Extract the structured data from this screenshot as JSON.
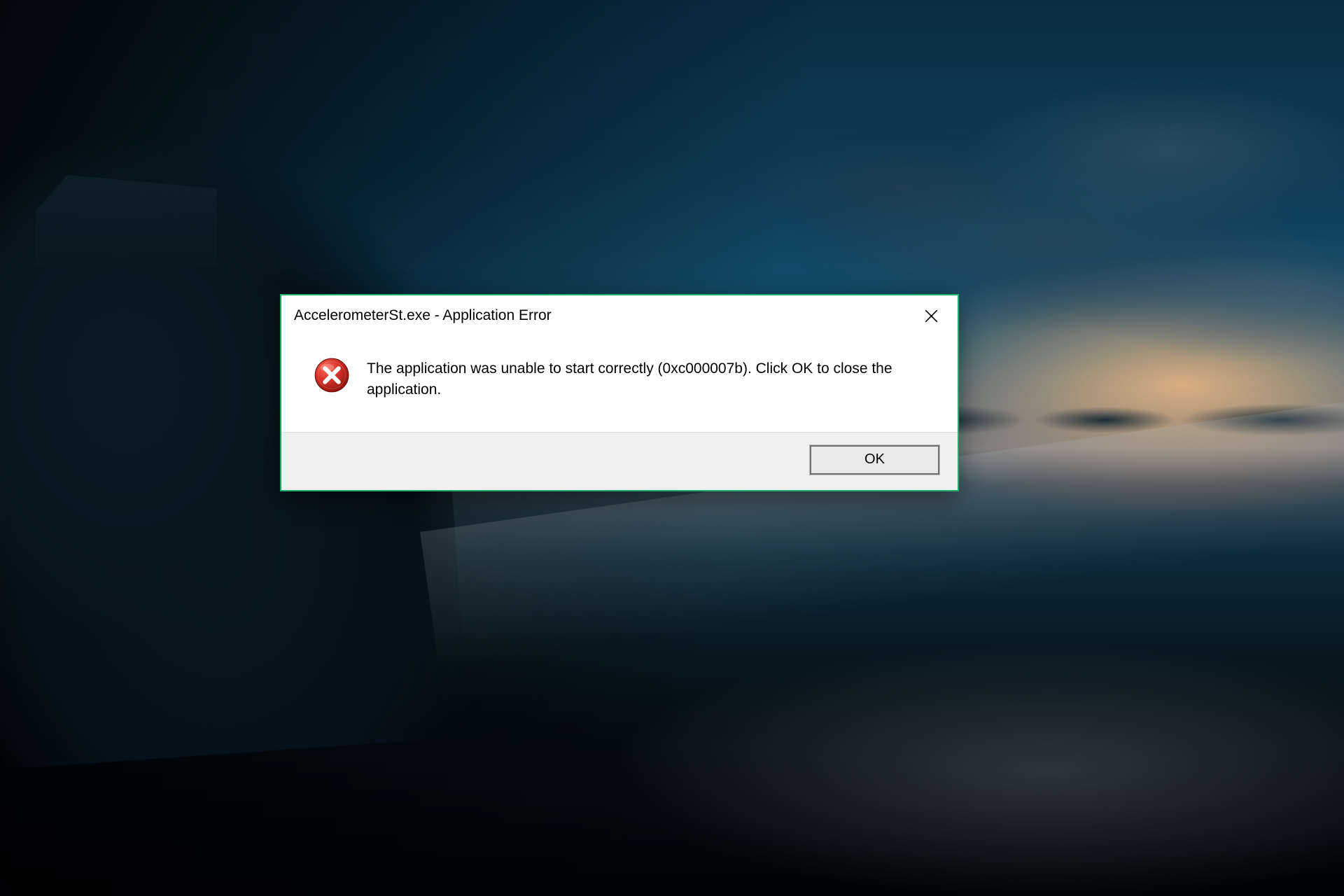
{
  "dialog": {
    "title": "AccelerometerSt.exe - Application Error",
    "message": "The application was unable to start correctly (0xc000007b). Click OK to close the application.",
    "ok_label": "OK",
    "icon": "error-icon",
    "accent_color": "#1fae6c",
    "error_icon_color": "#c42b1c"
  }
}
